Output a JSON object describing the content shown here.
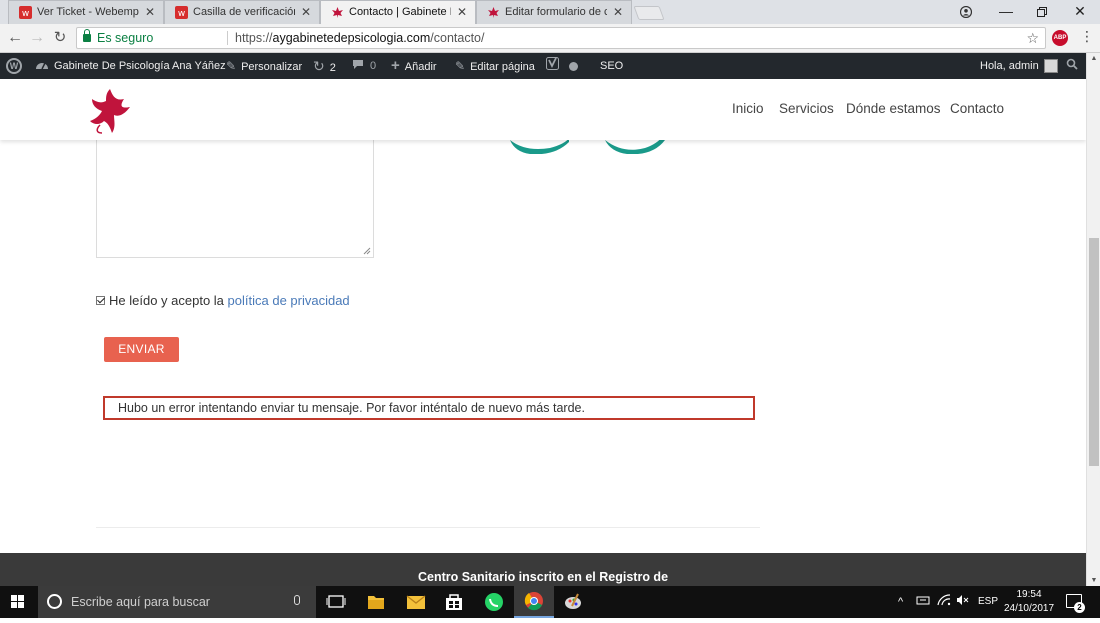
{
  "browser": {
    "tabs": [
      {
        "title": "Ver Ticket - Webempresa",
        "icon": "webempresa-icon"
      },
      {
        "title": "Casilla de verificación",
        "icon": "webempresa-icon"
      },
      {
        "title": "Contacto | Gabinete De Psicología",
        "icon": "maple-leaf-icon",
        "active": true
      },
      {
        "title": "Editar formulario de contacto",
        "icon": "maple-leaf-icon"
      }
    ],
    "secure_label": "Es seguro",
    "url_scheme": "https://",
    "url_host": "aygabinetedepsicologia.com",
    "url_path": "/contacto/",
    "abp_label": "ABP"
  },
  "adminbar": {
    "site_name": "Gabinete De Psicología Ana Yáñez",
    "customize": "Personalizar",
    "updates_count": "2",
    "comments_count": "0",
    "add_new": "Añadir",
    "edit_page": "Editar página",
    "seo": "SEO",
    "greeting": "Hola, admin"
  },
  "site": {
    "nav": [
      "Inicio",
      "Servicios",
      "Dónde estamos",
      "Contacto"
    ],
    "consent_prefix": "He leído y acepto la ",
    "consent_link": "política de privacidad",
    "consent_checked": true,
    "submit_label": "ENVIAR",
    "error_message": "Hubo un error intentando enviar tu mensaje. Por favor inténtalo de nuevo más tarde.",
    "footer_text": "Centro Sanitario inscrito en el Registro de"
  },
  "taskbar": {
    "search_placeholder": "Escribe aquí para buscar",
    "language": "ESP",
    "time": "19:54",
    "date": "24/10/2017",
    "notifications": "2"
  },
  "colors": {
    "accent_button": "#e8624f",
    "error_border": "#c0392b",
    "link": "#4a7ab8",
    "admin_bar": "#23282d",
    "footer": "#3a3a3a",
    "teal": "#1a9a8a"
  }
}
